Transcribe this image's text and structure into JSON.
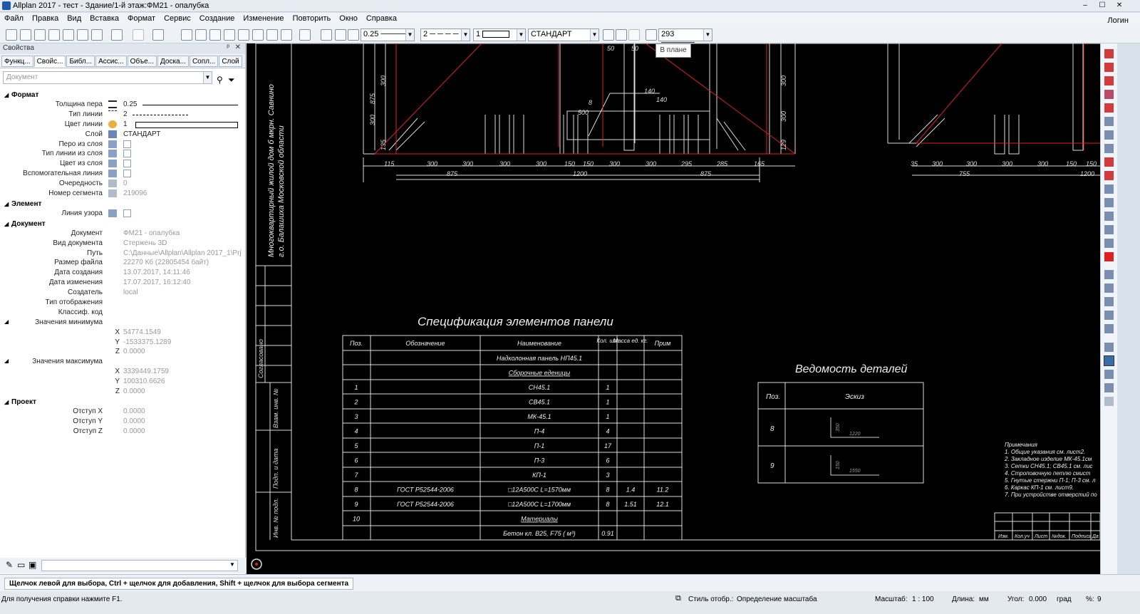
{
  "window": {
    "title": "Allplan 2017 - тест - Здание/1-й этаж:ФМ21 - опалубка",
    "minimize": "–",
    "maximize": "☐",
    "close": "✕"
  },
  "menu": {
    "items": [
      "Файл",
      "Правка",
      "Вид",
      "Вставка",
      "Формат",
      "Сервис",
      "Создание",
      "Изменение",
      "Повторить",
      "Окно",
      "Справка"
    ],
    "login": "Логин"
  },
  "toolbar": {
    "pen": "0.25",
    "linetype": "2",
    "color": "1",
    "layer": "СТАНДАРТ",
    "pattern": "293"
  },
  "panel": {
    "title": "Свойства",
    "pin": "ᵖ",
    "close": "✕",
    "tabs": [
      "Функц...",
      "Свойс...",
      "Библ...",
      "Ассис...",
      "Объе...",
      "Доска...",
      "Сопл...",
      "Слой"
    ],
    "doc_placeholder": "Документ",
    "format": {
      "header": "Формат",
      "pen_label": "Толщина пера",
      "pen_value": "0.25",
      "linetype_label": "Тип линии",
      "linetype_value": "2",
      "color_label": "Цвет линии",
      "color_value": "1",
      "layer_label": "Слой",
      "layer_value": "СТАНДАРТ",
      "pen_from_layer": "Перо из слоя",
      "lt_from_layer": "Тип линии из слоя",
      "col_from_layer": "Цвет из слоя",
      "aux_line": "Вспомогательная линия",
      "order_label": "Очередность",
      "order_value": "0",
      "segment_label": "Номер сегмента",
      "segment_value": "219096"
    },
    "element": {
      "header": "Элемент",
      "pattern_line": "Линия узора"
    },
    "document": {
      "header": "Документ",
      "doc_label": "Документ",
      "doc_value": "ФМ21 - опалубка",
      "kind_label": "Вид документа",
      "kind_value": "Стержень 3D",
      "path_label": "Путь",
      "path_value": "C:\\Данные\\Allplan\\Allplan 2017_1\\Prj\\т",
      "size_label": "Размер файла",
      "size_value": "22270 Кб (22805454 байт)",
      "created_label": "Дата создания",
      "created_value": "13.07.2017, 14:11:46",
      "modified_label": "Дата изменения",
      "modified_value": "17.07.2017, 16:12:40",
      "author_label": "Создатель",
      "author_value": "local",
      "display_label": "Тип отображения",
      "class_label": "Классиф. код",
      "min_label": "Значения минимума",
      "min_x": "54774.1549",
      "min_y": "-1533375.1289",
      "min_z": "0.0000",
      "max_label": "Значения максимума",
      "max_x": "3339449.1759",
      "max_y": "100310.6626",
      "max_z": "0.0000",
      "x": "X",
      "y": "Y",
      "z": "Z"
    },
    "project": {
      "header": "Проект",
      "ox_label": "Отступ X",
      "ox": "0.0000",
      "oy_label": "Отступ Y",
      "oy": "0.0000",
      "oz_label": "Отступ Z",
      "oz": "0.0000"
    }
  },
  "tooltip": "В плане",
  "drawing": {
    "spec_title": "Спецификация элементов панели",
    "spec_headers": [
      "Поз.",
      "Обозначение",
      "Наименование",
      "Кол. шт",
      "Масса ед. кг.",
      "Прим"
    ],
    "spec_rows": [
      [
        "",
        "",
        "Надколонная панель НП45.1",
        "",
        "",
        ""
      ],
      [
        "",
        "",
        "Сборочные еденицы",
        "",
        "",
        ""
      ],
      [
        "1",
        "",
        "СН45.1",
        "1",
        "",
        ""
      ],
      [
        "2",
        "",
        "СВ45.1",
        "1",
        "",
        ""
      ],
      [
        "3",
        "",
        "МК-45.1",
        "1",
        "",
        ""
      ],
      [
        "4",
        "",
        "П-4",
        "4",
        "",
        ""
      ],
      [
        "5",
        "",
        "П-1",
        "17",
        "",
        ""
      ],
      [
        "6",
        "",
        "П-3",
        "6",
        "",
        ""
      ],
      [
        "7",
        "",
        "КП-1",
        "3",
        "",
        ""
      ],
      [
        "8",
        "ГОСТ Р52544-2006",
        "□12А500С          L=1570мм",
        "8",
        "1.4",
        "11.2"
      ],
      [
        "9",
        "ГОСТ Р52544-2006",
        "□12А500С          L=1700мм",
        "8",
        "1.51",
        "12.1"
      ],
      [
        "10",
        "",
        "Материалы",
        "",
        "",
        ""
      ],
      [
        "",
        "",
        "Бетон кл. В25, F75        (        м³)",
        "0.91",
        "",
        ""
      ]
    ],
    "detail_title": "Ведомость деталей",
    "detail_headers": [
      "Поз.",
      "Эскиз"
    ],
    "detail_rows": [
      {
        "pos": "8",
        "a": "350",
        "b": "1220"
      },
      {
        "pos": "9",
        "a": "150",
        "b": "1550"
      }
    ],
    "notes": [
      "Примечания",
      "1. Общие указания см. лист2.",
      "2. Закладное изделие МК-45.1см",
      "3. Сетки СН45.1; СВ45.1 см. лис",
      "4. Строповочную петлю смист",
      "5. Гнутые стержни П-1; П-3 см. л",
      "6. Каркас КП-1 см. лист9.",
      "7. При устройстве отверстий по"
    ],
    "vertical_title1": "Многоквартирный жилой дом б мкрн. Савнино",
    "vertical_title2": "г.о. Балашиха Московской области",
    "stamp_labels": [
      "Согласовано",
      "Взам. инв. №",
      "Подп. и дата",
      "Инв. № подл."
    ],
    "title_block": [
      "Изм.",
      "Кол.уч",
      "Лист",
      "№док.",
      "Подпись",
      "Да"
    ],
    "dims_left": [
      "115",
      "300",
      "300",
      "300",
      "300",
      "150",
      "150",
      "300",
      "300",
      "295",
      "285",
      "165"
    ],
    "dims_total": [
      "875",
      "1200",
      "875"
    ],
    "dims_right": [
      "35",
      "300",
      "300",
      "300",
      "300",
      "150",
      "150"
    ],
    "dims_right_total": [
      "755",
      "1200"
    ]
  },
  "status": {
    "hint": "Щелчок левой для выбора, Ctrl + щелчок для добавления, Shift + щелчок для выбора сегмента",
    "help": "Для получения справки нажмите F1.",
    "style_label": "Стиль отобр.:",
    "style_value": "Определение масштаба",
    "scale_label": "Масштаб:",
    "scale_value": "1 : 100",
    "len_label": "Длина:",
    "len_value": "мм",
    "angle_label": "Угол:",
    "angle_value": "0.000",
    "angle_unit": "град",
    "pct_label": "%:",
    "pct_value": "9"
  }
}
